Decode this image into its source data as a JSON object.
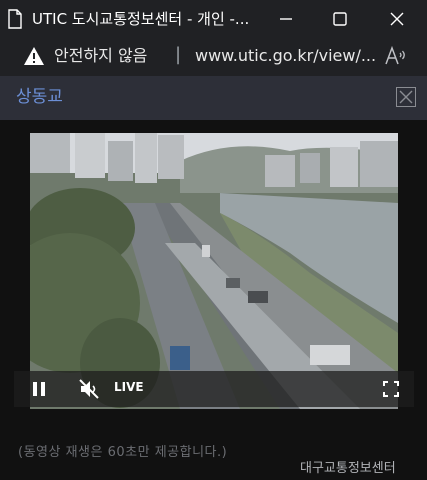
{
  "window": {
    "title": "UTIC 도시교통정보센터 - 개인 -...",
    "minimize_icon": "minimize-icon",
    "maximize_icon": "maximize-icon",
    "close_icon": "close-icon"
  },
  "address_bar": {
    "security_text": "안전하지 않음",
    "separator": "|",
    "url": "www.utic.go.kr/view/...",
    "warning_icon": "warning-triangle-icon",
    "read_aloud_icon": "read-aloud-icon"
  },
  "panel": {
    "title": "상동교",
    "close_icon": "close-icon"
  },
  "player": {
    "live_label": "LIVE",
    "state": "playing",
    "muted": true
  },
  "footer": {
    "notice": "(동영상 재생은 60초만 제공합니다.)",
    "credit": "대구교통정보센터"
  },
  "colors": {
    "chrome_bg": "#202124",
    "panel_header_bg": "#2d2f38",
    "panel_title": "#6c8fd6",
    "page_bg": "#111111"
  }
}
